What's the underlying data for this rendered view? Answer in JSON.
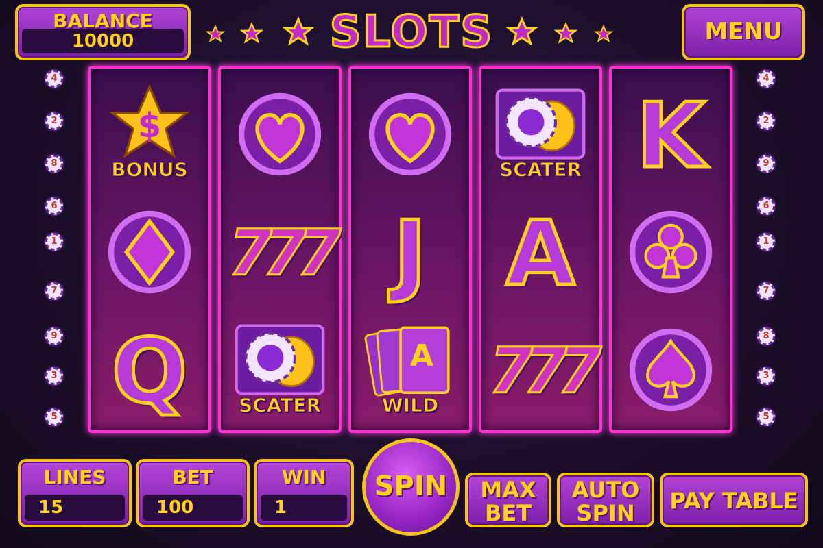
{
  "title": "SLOTS",
  "balance": {
    "label": "BALANCE",
    "value": "10000"
  },
  "menu_label": "MENU",
  "left_lines": [
    "4",
    "2",
    "8",
    "6",
    "1",
    "7",
    "9",
    "3",
    "5"
  ],
  "right_lines": [
    "4",
    "2",
    "9",
    "6",
    "1",
    "7",
    "8",
    "3",
    "5"
  ],
  "reels": [
    {
      "symbols": [
        {
          "icon": "bonus-star-icon",
          "label": "BONUS"
        },
        {
          "icon": "diamond-suit-icon",
          "label": ""
        },
        {
          "icon": "letter-q-icon",
          "text": "Q"
        }
      ]
    },
    {
      "symbols": [
        {
          "icon": "heart-suit-icon",
          "label": ""
        },
        {
          "icon": "lucky-seven-icon",
          "text": "777"
        },
        {
          "icon": "chips-scatter-icon",
          "label": "SCATER"
        }
      ]
    },
    {
      "symbols": [
        {
          "icon": "heart-suit-icon",
          "label": ""
        },
        {
          "icon": "letter-j-icon",
          "text": "J"
        },
        {
          "icon": "cards-wild-icon",
          "label": "WILD",
          "card": "A"
        }
      ]
    },
    {
      "symbols": [
        {
          "icon": "chips-scatter-icon",
          "label": "SCATER"
        },
        {
          "icon": "letter-a-icon",
          "text": "A"
        },
        {
          "icon": "lucky-seven-icon",
          "text": "777"
        }
      ]
    },
    {
      "symbols": [
        {
          "icon": "letter-k-icon",
          "text": "K"
        },
        {
          "icon": "club-suit-icon",
          "label": ""
        },
        {
          "icon": "spade-suit-icon",
          "label": ""
        }
      ]
    }
  ],
  "bottom": {
    "lines": {
      "label": "LINES",
      "value": "15"
    },
    "bet": {
      "label": "BET",
      "value": "100"
    },
    "win": {
      "label": "WIN",
      "value": "1"
    },
    "spin_label": "SPIN",
    "max_bet_line1": "MAX",
    "max_bet_line2": "BET",
    "auto_spin_line1": "AUTO",
    "auto_spin_line2": "SPIN",
    "pay_table_label": "PAY TABLE"
  },
  "colors": {
    "accent_gold": "#ffd11c",
    "panel_purple": "#9b30c8",
    "reel_border": "#ff2fd0"
  }
}
